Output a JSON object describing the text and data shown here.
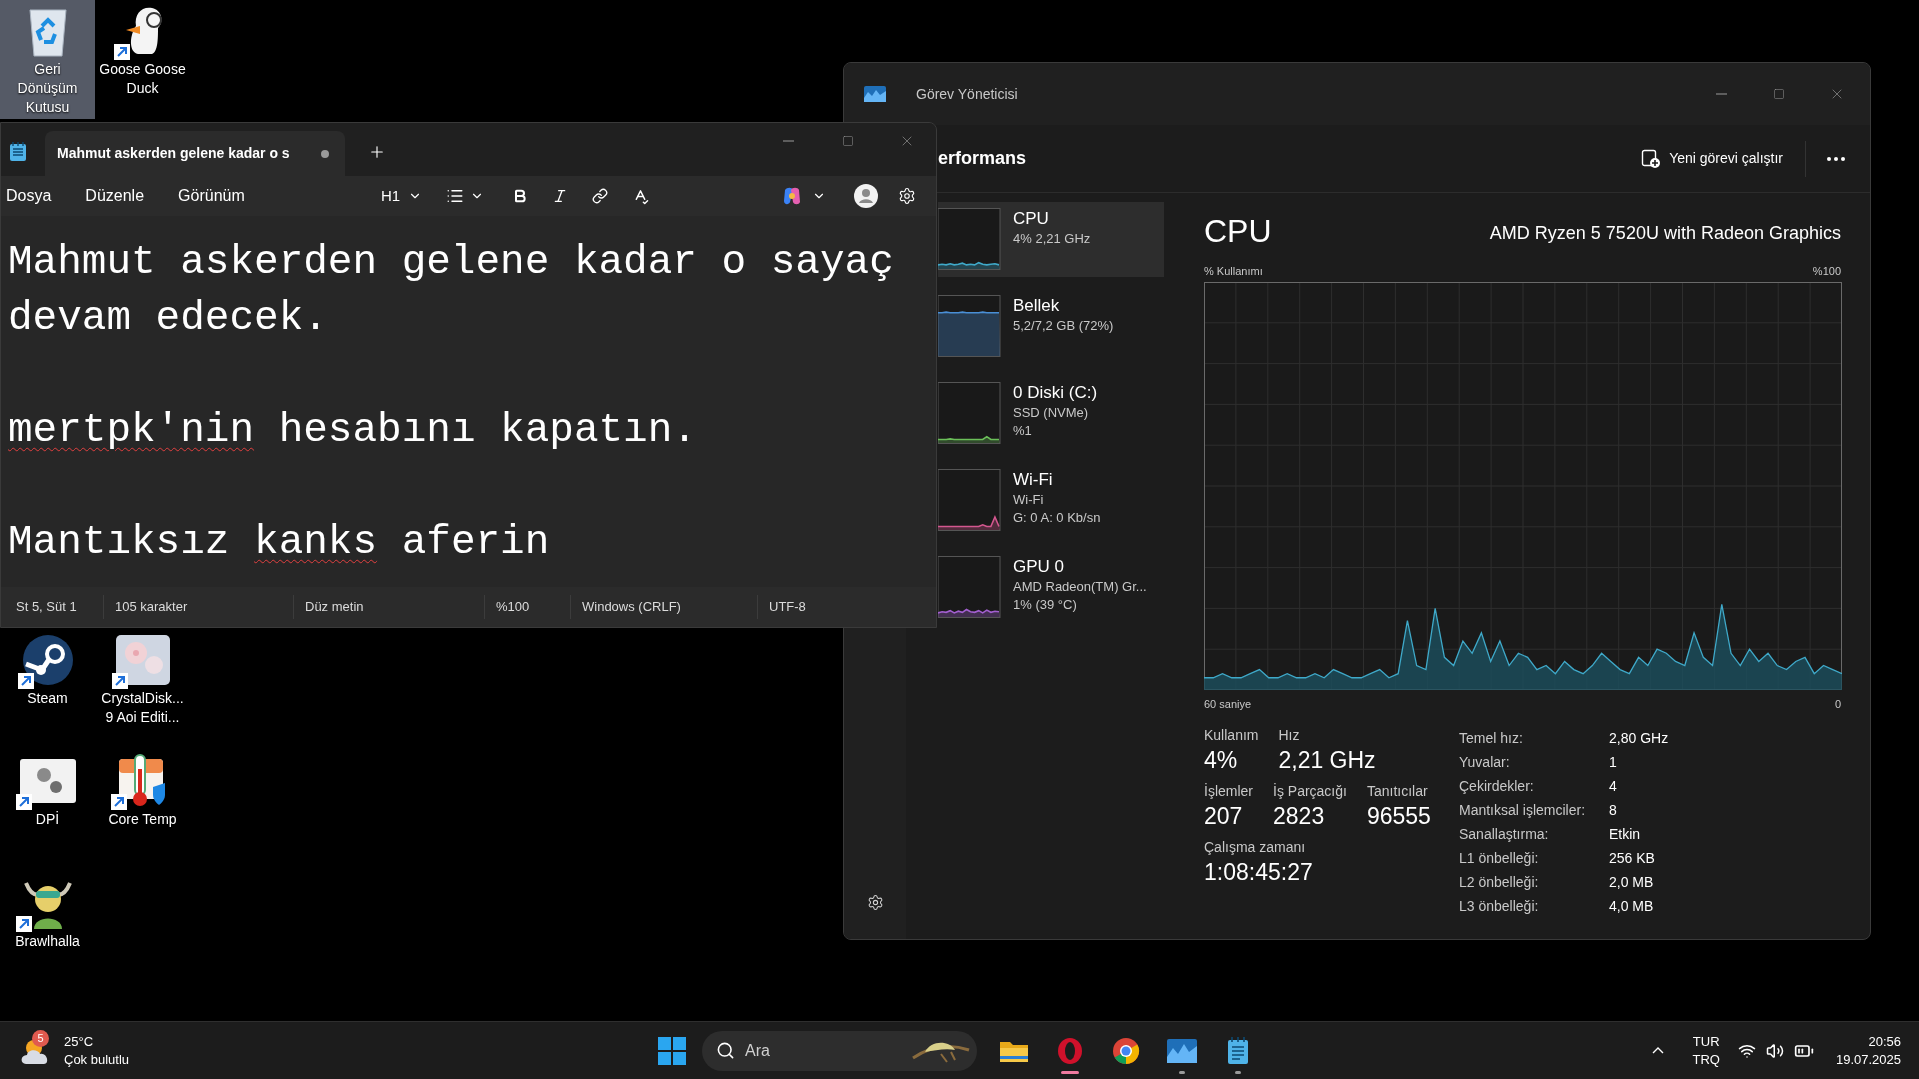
{
  "desktop": {
    "icons": [
      {
        "label": "Geri\nDönüşüm\nKutusu",
        "kind": "recycle",
        "shortcut": false,
        "selected": true
      },
      {
        "label": "Goose Goose\nDuck",
        "kind": "goose",
        "shortcut": true,
        "selected": false
      },
      {
        "label": "Steam",
        "kind": "steam",
        "shortcut": true,
        "selected": false
      },
      {
        "label": "CrystalDisk...\n9 Aoi Editi...",
        "kind": "crystal",
        "shortcut": true,
        "selected": false
      },
      {
        "label": "DPİ",
        "kind": "dpi",
        "shortcut": true,
        "selected": false
      },
      {
        "label": "Core Temp",
        "kind": "coretemp",
        "shortcut": true,
        "selected": false
      },
      {
        "label": "Brawlhalla",
        "kind": "brawl",
        "shortcut": true,
        "selected": false
      }
    ]
  },
  "task_manager": {
    "title": "Görev Yöneticisi",
    "page_title": "erformans",
    "run_task_button": "Yeni görevi çalıştır",
    "resources": [
      {
        "name": "CPU",
        "lines": [
          "4% 2,21 GHz"
        ],
        "color": "#3fa9c9",
        "selected": true
      },
      {
        "name": "Bellek",
        "lines": [
          "5,2/7,2 GB (72%)"
        ],
        "color": "#4a8fd6",
        "selected": false
      },
      {
        "name": "0 Diski (C:)",
        "lines": [
          "SSD (NVMe)",
          "%1"
        ],
        "color": "#6bbf59",
        "selected": false
      },
      {
        "name": "Wi-Fi",
        "lines": [
          "Wi-Fi",
          "G: 0 A: 0 Kb/sn"
        ],
        "color": "#d4578f",
        "selected": false
      },
      {
        "name": "GPU 0",
        "lines": [
          "AMD Radeon(TM) Gr...",
          "1% (39 °C)"
        ],
        "color": "#a35fd0",
        "selected": false
      }
    ],
    "detail": {
      "title": "CPU",
      "model": "AMD Ryzen 5 7520U with Radeon Graphics",
      "y_label": "% Kullanımı",
      "y_max": "%100",
      "x_label": "60 saniye",
      "x_min": "0",
      "stat_rows": [
        [
          {
            "label": "Kullanım",
            "value": "4%"
          },
          {
            "label": "Hız",
            "value": "2,21 GHz"
          }
        ],
        [
          {
            "label": "İşlemler",
            "value": "207"
          },
          {
            "label": "İş Parçacığı",
            "value": "2823"
          },
          {
            "label": "Tanıtıcılar",
            "value": "96555"
          }
        ],
        [
          {
            "label": "Çalışma zamanı",
            "value": "1:08:45:27"
          }
        ]
      ],
      "specs": [
        {
          "label": "Temel hız:",
          "value": "2,80 GHz"
        },
        {
          "label": "Yuvalar:",
          "value": "1"
        },
        {
          "label": "Çekirdekler:",
          "value": "4"
        },
        {
          "label": "Mantıksal işlemciler:",
          "value": "8"
        },
        {
          "label": "Sanallaştırma:",
          "value": "Etkin"
        },
        {
          "label": "L1 önbelleği:",
          "value": "256 KB"
        },
        {
          "label": "L2 önbelleği:",
          "value": "2,0 MB"
        },
        {
          "label": "L3 önbelleği:",
          "value": "4,0 MB"
        }
      ]
    }
  },
  "notepad": {
    "tabs": [
      {
        "title": "Mahmut askerden gelene kadar o s",
        "unsaved": true,
        "selected": true
      }
    ],
    "menu": [
      "Dosya",
      "Düzenle",
      "Görünüm"
    ],
    "heading_format": "H1",
    "paragraphs": [
      [
        {
          "text": "Mahmut askerden gelene kadar o sayaç devam edecek.",
          "misspelled": false
        }
      ],
      [
        {
          "text": "mertpk'nin",
          "misspelled": true
        },
        {
          "text": " hesabını kapatın.",
          "misspelled": false
        }
      ],
      [
        {
          "text": "Mantıksız ",
          "misspelled": false
        },
        {
          "text": "kanks",
          "misspelled": true
        },
        {
          "text": " aferin",
          "misspelled": false
        }
      ]
    ],
    "status_bar": [
      "St 5, Süt 1",
      "105 karakter",
      "Düz metin",
      "%100",
      "Windows (CRLF)",
      "UTF-8"
    ]
  },
  "taskbar": {
    "weather": {
      "badge": "5",
      "temperature": "25°C",
      "condition": "Çok bulutlu"
    },
    "search": {
      "placeholder": "Ara"
    },
    "apps": [
      {
        "kind": "explorer",
        "running": false,
        "active": false
      },
      {
        "kind": "opera",
        "running": true,
        "active": true
      },
      {
        "kind": "chrome",
        "running": false,
        "active": false
      },
      {
        "kind": "taskmanager",
        "running": true,
        "active": false
      },
      {
        "kind": "notepad",
        "running": true,
        "active": false
      }
    ],
    "language": [
      "TUR",
      "TRQ"
    ],
    "time": "20:56",
    "date": "19.07.2025"
  }
}
